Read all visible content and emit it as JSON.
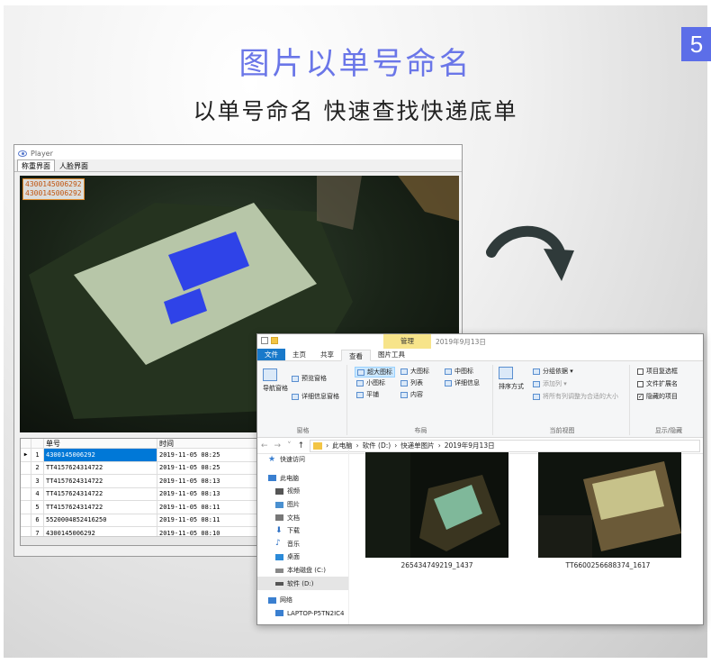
{
  "badge": "5",
  "title": "图片以单号命名",
  "subtitle": "以单号命名  快速查找快递底单",
  "player": {
    "window_title": "Player",
    "tabs": [
      "称重界面",
      "人脸界面"
    ],
    "overlay_lines": [
      "4300145006292",
      "4300145006292"
    ],
    "table": {
      "headers": [
        "单号",
        "时间"
      ],
      "rows": [
        {
          "num": "1",
          "code": "4300145006292",
          "time": "2019-11-05 08:25"
        },
        {
          "num": "2",
          "code": "TT4157624314722",
          "time": "2019-11-05 08:25"
        },
        {
          "num": "3",
          "code": "TT4157624314722",
          "time": "2019-11-05 08:13"
        },
        {
          "num": "4",
          "code": "TT4157624314722",
          "time": "2019-11-05 08:13"
        },
        {
          "num": "5",
          "code": "TT4157624314722",
          "time": "2019-11-05 08:11"
        },
        {
          "num": "6",
          "code": "5520004852416250",
          "time": "2019-11-05 08:11"
        },
        {
          "num": "7",
          "code": "4300145006292",
          "time": "2019-11-05 08:10"
        }
      ]
    }
  },
  "explorer": {
    "manage_tab": "管理",
    "window_title": "2019年9月13日",
    "tabs": [
      "文件",
      "主页",
      "共享",
      "查看"
    ],
    "context_tab": "图片工具",
    "ribbon": {
      "pane_group": {
        "nav_pane": "导航窗格",
        "preview_pane": "预览窗格",
        "details_pane": "详细信息窗格",
        "label": "窗格"
      },
      "layout_group": {
        "items": [
          "超大图标",
          "大图标",
          "中图标",
          "小图标",
          "列表",
          "详细信息",
          "平铺",
          "内容"
        ],
        "label": "布局"
      },
      "view_group": {
        "sort": "排序方式",
        "group_by": "分组依据 ▾",
        "add_column": "添加列 ▾",
        "fit_columns": "将所有列调整为合适的大小",
        "label": "当前视图"
      },
      "show_group": {
        "item_check": "项目复选框",
        "file_ext": "文件扩展名",
        "hidden_items": "隐藏的项目",
        "hide_selected": "隐藏所选项目",
        "label": "显示/隐藏"
      }
    },
    "breadcrumb": [
      "此电脑",
      "软件 (D:)",
      "快递单图片",
      "2019年9月13日"
    ],
    "nav_items": [
      {
        "label": "快速访问",
        "color": "#3a7fd0"
      },
      {
        "label": "此电脑",
        "color": "#3a7fd0"
      },
      {
        "label": "视频",
        "color": "#555"
      },
      {
        "label": "图片",
        "color": "#4a90d0"
      },
      {
        "label": "文档",
        "color": "#777"
      },
      {
        "label": "下载",
        "color": "#2b6fc4"
      },
      {
        "label": "音乐",
        "color": "#2b6fc4"
      },
      {
        "label": "桌面",
        "color": "#2b8ad8"
      },
      {
        "label": "本地磁盘 (C:)",
        "color": "#888"
      },
      {
        "label": "软件 (D:)",
        "color": "#555"
      },
      {
        "label": "网络",
        "color": "#3a7fd0"
      },
      {
        "label": "LAPTOP-P5TN2IC4",
        "color": "#3a7fd0"
      }
    ],
    "files": [
      "265434749219_1437",
      "TT6600256688374_1617"
    ]
  }
}
